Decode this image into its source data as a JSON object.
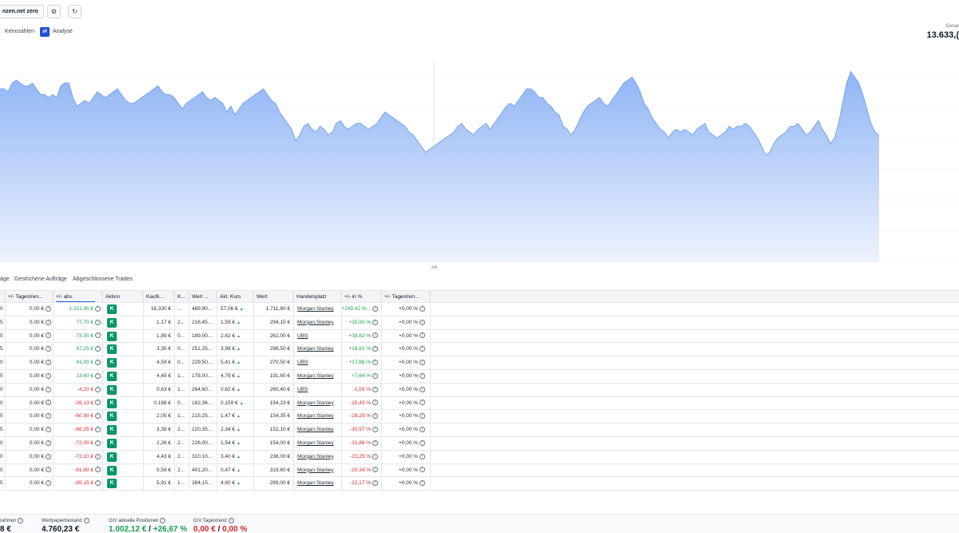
{
  "header": {
    "account_label": "nzen.net zero",
    "settings_icon": "gear-icon",
    "refresh_icon": "refresh-icon",
    "tabs": [
      "Kennzahlen",
      "Analyse"
    ],
    "total_label": "Gesar",
    "total_value": "13.633,("
  },
  "chart_data": {
    "type": "area",
    "x_tick_label": "Juli",
    "fill_top": "#8fb4f5",
    "fill_bottom": "#eef3fd",
    "stroke": "#7aa4ef",
    "y": [
      60,
      60,
      59,
      62,
      63,
      62,
      61,
      61,
      62,
      60,
      58,
      58,
      57,
      58,
      57,
      61,
      62,
      62,
      57,
      54,
      55,
      56,
      55,
      57,
      59,
      58,
      57,
      58,
      59,
      60,
      58,
      56,
      55,
      55,
      56,
      57,
      58,
      59,
      60,
      61,
      59,
      58,
      58,
      57,
      55,
      53,
      55,
      56,
      57,
      58,
      59,
      57,
      56,
      57,
      56,
      55,
      52,
      54,
      51,
      53,
      55,
      56,
      57,
      58,
      59,
      60,
      58,
      56,
      55,
      52,
      50,
      48,
      46,
      42,
      44,
      47,
      48,
      46,
      45,
      47,
      46,
      44,
      45,
      48,
      49,
      47,
      46,
      47,
      48,
      48,
      47,
      46,
      47,
      48,
      50,
      52,
      51,
      50,
      49,
      48,
      47,
      45,
      44,
      42,
      40,
      38,
      39,
      40,
      41,
      42,
      43,
      44,
      45,
      47,
      48,
      46,
      45,
      44,
      46,
      47,
      48,
      46,
      48,
      50,
      52,
      54,
      55,
      54,
      56,
      58,
      60,
      60,
      59,
      57,
      57,
      55,
      54,
      52,
      51,
      47,
      46,
      44,
      46,
      49,
      52,
      54,
      55,
      56,
      57,
      55,
      54,
      56,
      58,
      60,
      62,
      63,
      64,
      62,
      59,
      55,
      53,
      50,
      48,
      46,
      45,
      43,
      45,
      46,
      45,
      46,
      45,
      44,
      46,
      47,
      48,
      45,
      44,
      43,
      44,
      45,
      47,
      46,
      47,
      47,
      48,
      47,
      45,
      43,
      40,
      37,
      38,
      41,
      43,
      44,
      45,
      47,
      47,
      48,
      46,
      44,
      45,
      47,
      49,
      46,
      44,
      41,
      43,
      48,
      55,
      62,
      66,
      64,
      62,
      58,
      53,
      48,
      45,
      44
    ],
    "ylim": [
      0,
      70
    ]
  },
  "subtabs": [
    "äge",
    "Gestrichene Aufträge",
    "Abgeschlossene Trades"
  ],
  "table": {
    "columns": [
      "+/- Tagestren...",
      "+/- abs.",
      "Aktion",
      "Kaufk...",
      "K...",
      "Wert ...",
      "Akt. Kurs",
      "Wert",
      "Handelsplatz",
      "+/- in %",
      "+/- Tagestren..."
    ],
    "action_label": "K",
    "rows": [
      {
        "c0": "0",
        "trend": "0,00 €",
        "abs": "1.221,90 €",
        "abs_sign": "pos",
        "kauf": "16,330 €",
        "k": "...",
        "wert1": "489,90...",
        "kurs": "57,06 €",
        "wert": "1.711,80 €",
        "venue": "Morgan Stanley",
        "pct": "+249,42 %...",
        "pct_sign": "pos",
        "trend2": "+0,00 %"
      },
      {
        "c0": "5",
        "trend": "0,00 €",
        "abs": "77,70 €",
        "abs_sign": "pos",
        "kauf": "1,17 €",
        "k": "2...",
        "wert1": "216,45...",
        "kurs": "1,59 €",
        "wert": "294,15 €",
        "venue": "Morgan Stanley",
        "pct": "+35,90 %",
        "pct_sign": "pos",
        "trend2": "+0,00 %"
      },
      {
        "c0": "0",
        "trend": "0,00 €",
        "abs": "73,00 €",
        "abs_sign": "pos",
        "kauf": "1,89 €",
        "k": "0...",
        "wert1": "189,00...",
        "kurs": "2,62 €",
        "wert": "262,00 €",
        "venue": "UBS",
        "pct": "+38,62 %",
        "pct_sign": "pos",
        "trend2": "+0,00 %"
      },
      {
        "c0": "5",
        "trend": "0,00 €",
        "abs": "47,25 €",
        "abs_sign": "pos",
        "kauf": "3,35 €",
        "k": "0...",
        "wert1": "251,25...",
        "kurs": "3,98 €",
        "wert": "298,50 €",
        "venue": "Morgan Stanley",
        "pct": "+18,81 %",
        "pct_sign": "pos",
        "trend2": "+0,00 %"
      },
      {
        "c0": "0",
        "trend": "0,00 €",
        "abs": "41,00 €",
        "abs_sign": "pos",
        "kauf": "4,59 €",
        "k": "0...",
        "wert1": "229,50...",
        "kurs": "5,41 €",
        "wert": "270,50 €",
        "venue": "UBS",
        "pct": "+17,86 %",
        "pct_sign": "pos",
        "trend2": "+0,00 %"
      },
      {
        "c0": "0",
        "trend": "0,00 €",
        "abs": "13,60 €",
        "abs_sign": "pos",
        "kauf": "4,45 €",
        "k": "1...",
        "wert1": "178,00...",
        "kurs": "4,79 €",
        "wert": "191,60 €",
        "venue": "Morgan Stanley",
        "pct": "+7,64 %",
        "pct_sign": "pos",
        "trend2": "+0,00 %"
      },
      {
        "c0": "0",
        "trend": "0,00 €",
        "abs": "-4,20 €",
        "abs_sign": "neg",
        "kauf": "0,63 €",
        "k": "1...",
        "wert1": "264,60...",
        "kurs": "0,62 €",
        "wert": "260,40 €",
        "venue": "UBS",
        "pct": "-1,59 %",
        "pct_sign": "neg",
        "trend2": "+0,00 %"
      },
      {
        "c0": "0",
        "trend": "0,00 €",
        "abs": "-28,13 €",
        "abs_sign": "neg",
        "kauf": "0,188 €",
        "k": "0...",
        "wert1": "182,36...",
        "kurs": "0,159 €",
        "wert": "154,23 €",
        "venue": "Morgan Stanley",
        "pct": "-15,43 %",
        "pct_sign": "neg",
        "trend2": "+0,00 %"
      },
      {
        "c0": "0",
        "trend": "0,00 €",
        "abs": "-60,90 €",
        "abs_sign": "neg",
        "kauf": "2,05 €",
        "k": "1...",
        "wert1": "215,25...",
        "kurs": "1,47 €",
        "wert": "154,35 €",
        "venue": "Morgan Stanley",
        "pct": "-28,29 %",
        "pct_sign": "neg",
        "trend2": "+0,00 %"
      },
      {
        "c0": "5",
        "trend": "0,00 €",
        "abs": "-68,25 €",
        "abs_sign": "neg",
        "kauf": "3,39 €",
        "k": "2...",
        "wert1": "220,35...",
        "kurs": "2,34 €",
        "wert": "152,10 €",
        "venue": "Morgan Stanley",
        "pct": "-30,97 %",
        "pct_sign": "neg",
        "trend2": "+0,00 %"
      },
      {
        "c0": "0",
        "trend": "0,00 €",
        "abs": "-72,00 €",
        "abs_sign": "neg",
        "kauf": "2,26 €",
        "k": "2...",
        "wert1": "226,00...",
        "kurs": "1,54 €",
        "wert": "154,00 €",
        "venue": "Morgan Stanley",
        "pct": "-31,86 %",
        "pct_sign": "neg",
        "trend2": "+0,00 %"
      },
      {
        "c0": "0",
        "trend": "0,00 €",
        "abs": "-72,10 €",
        "abs_sign": "neg",
        "kauf": "4,43 €",
        "k": "2...",
        "wert1": "310,10...",
        "kurs": "3,40 €",
        "wert": "238,00 €",
        "venue": "Morgan Stanley",
        "pct": "-23,25 %",
        "pct_sign": "neg",
        "trend2": "+0,00 %"
      },
      {
        "c0": "0",
        "trend": "0,00 €",
        "abs": "-81,60 €",
        "abs_sign": "neg",
        "kauf": "0,59 €",
        "k": "2...",
        "wert1": "401,20...",
        "kurs": "0,47 €",
        "wert": "319,60 €",
        "venue": "Morgan Stanley",
        "pct": "-20,34 %",
        "pct_sign": "neg",
        "trend2": "+0,00 %"
      },
      {
        "c0": "5",
        "trend": "0,00 €",
        "abs": "-85,15 €",
        "abs_sign": "neg",
        "kauf": "5,91 €",
        "k": "1...",
        "wert1": "384,15...",
        "kurs": "4,60 €",
        "wert": "299,00 €",
        "venue": "Morgan Stanley",
        "pct": "-22,17 %",
        "pct_sign": "neg",
        "trend2": "+0,00 %"
      }
    ]
  },
  "footer": {
    "items": [
      {
        "label": "rahmen",
        "value": "8 €",
        "sign": "none"
      },
      {
        "label": "Wertpapierbestand",
        "value": "4.760,23 €",
        "sign": "none"
      },
      {
        "label": "G/V aktuelle Positionen",
        "value_a": "1.002,12 €",
        "sep": " / ",
        "value_b": "+26,67 %",
        "sign": "pos"
      },
      {
        "label": "G/V Tagestrend",
        "value_a": "0,00 €",
        "sep": " / ",
        "value_b": "0,00 %",
        "sign": "neg"
      }
    ]
  }
}
